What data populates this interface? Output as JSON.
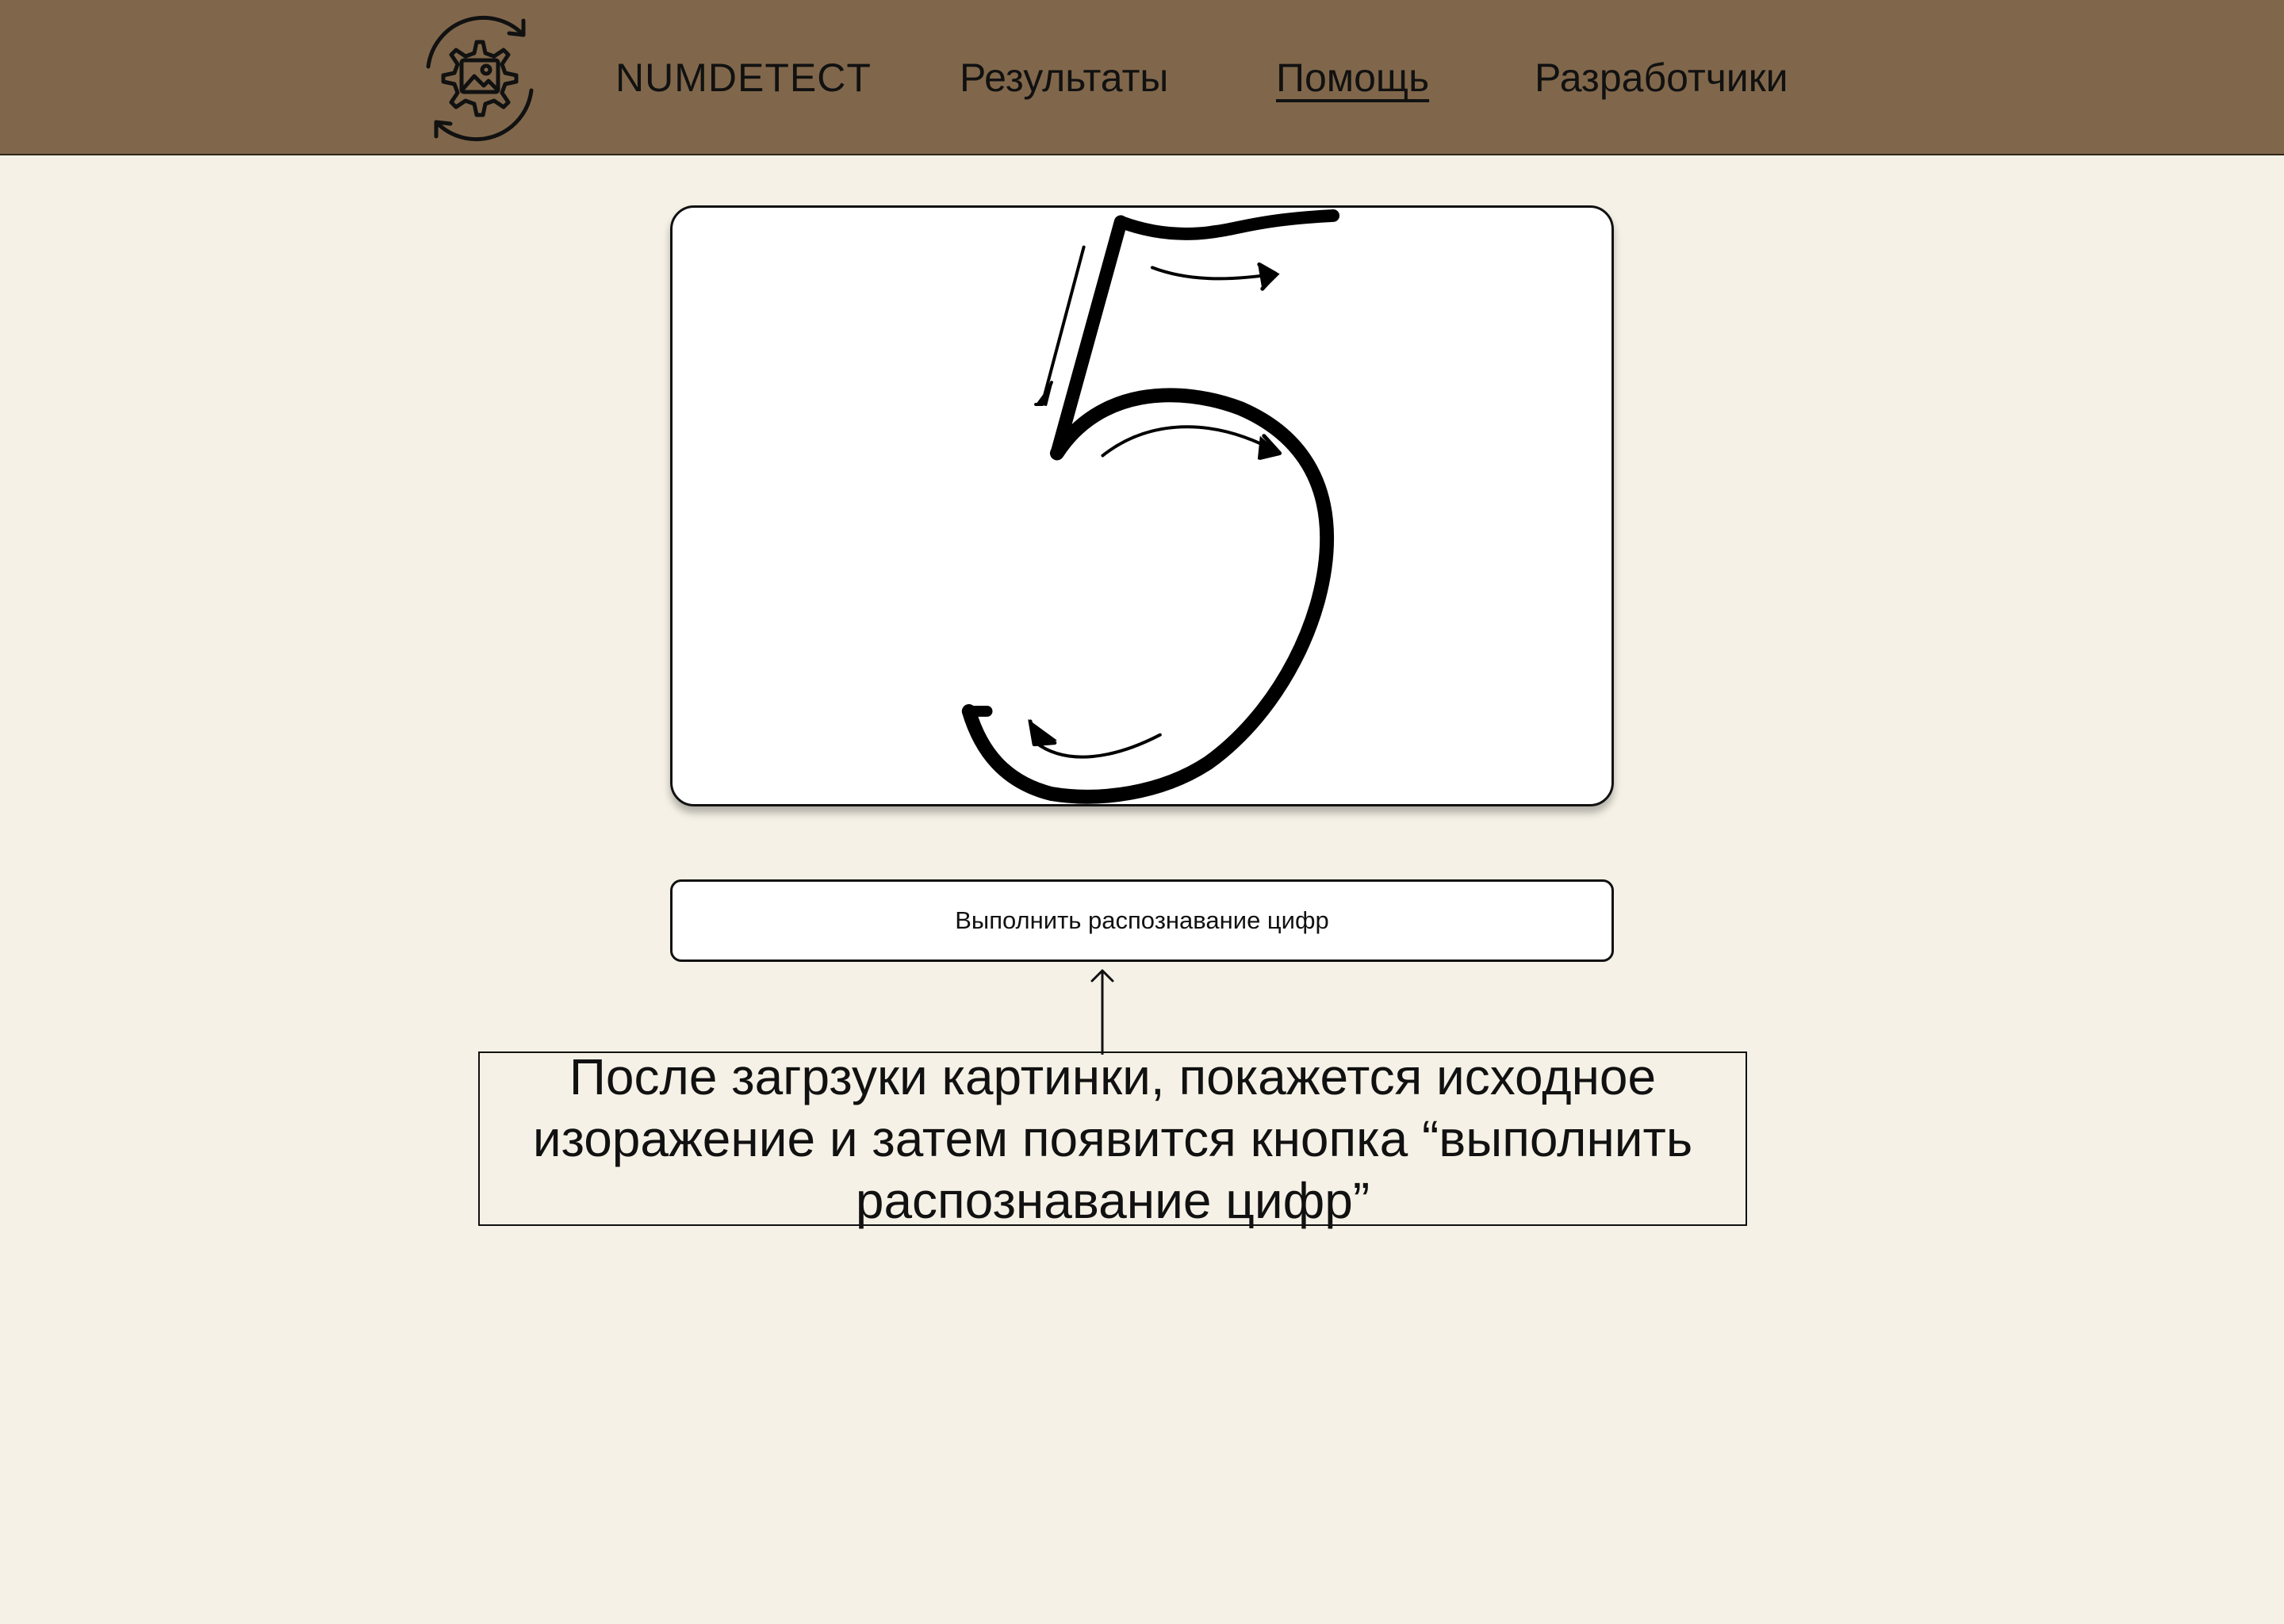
{
  "nav": {
    "brand": "NUMDETECT",
    "results": "Результаты",
    "help": "Помощь",
    "developers": "Разработчики",
    "logo_icon": "gear-image-refresh-icon"
  },
  "preview": {
    "image_icon": "handwritten-digit-5-image"
  },
  "actions": {
    "recognize_label": "Выполнить распознавание цифр"
  },
  "annotation": {
    "text": "После загрзуки картинки, покажется исходное изоражение и затем появится кнопка “выполнить распознавание цифр”"
  },
  "colors": {
    "header_bg": "#80674b",
    "page_bg": "#f5f1e6",
    "panel_bg": "#ffffff",
    "text": "#111111"
  }
}
